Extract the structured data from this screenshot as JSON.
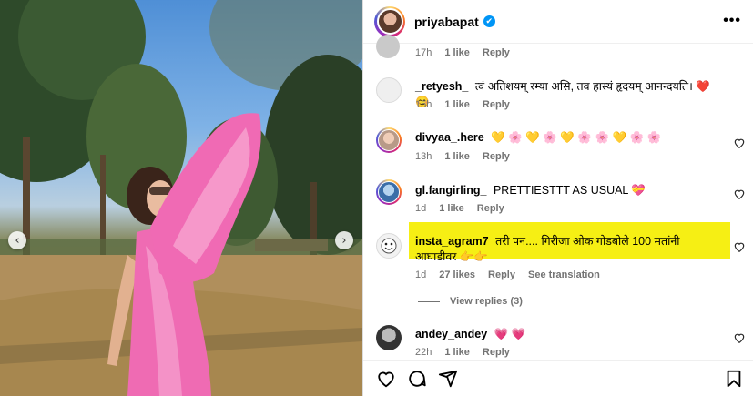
{
  "post": {
    "username": "priyabapat",
    "more_label": "•••",
    "verified_icon": "✔"
  },
  "photo": {
    "prev_arrow": "‹",
    "next_arrow": "›"
  },
  "comments": [
    {
      "user": "",
      "text": "",
      "time": "17h",
      "likes": "1 like",
      "reply": "Reply"
    },
    {
      "user": "_retyesh_",
      "text": "त्वं अतिशयम् रम्या असि, तव हास्यं हृदयम् आनन्दयति। ❤️ 😊",
      "time": "15h",
      "likes": "1 like",
      "reply": "Reply"
    },
    {
      "user": "divyaa_.here",
      "text": "💛 🌸 💛 🌸 💛 🌸 🌸 💛 🌸 🌸",
      "time": "13h",
      "likes": "1 like",
      "reply": "Reply"
    },
    {
      "user": "gl.fangirling_",
      "text": "PRETTIESTTT AS USUAL 💝",
      "time": "1d",
      "likes": "1 like",
      "reply": "Reply"
    },
    {
      "user": "insta_agram7",
      "text": "तरी पन.... गिरीजा ओक गोडबोले 100 मतांनी आघाडीवर 👉👉",
      "time": "1d",
      "likes": "27 likes",
      "reply": "Reply",
      "translate": "See translation"
    },
    {
      "user": "andey_andey",
      "text": "💗 💗",
      "time": "22h",
      "likes": "1 like",
      "reply": "Reply"
    }
  ],
  "view_replies": "View replies (3)",
  "colors": {
    "highlight": "#f6ef14",
    "meta": "#737373",
    "verified": "#0095f6",
    "saree_pink": "#f06ab4"
  }
}
